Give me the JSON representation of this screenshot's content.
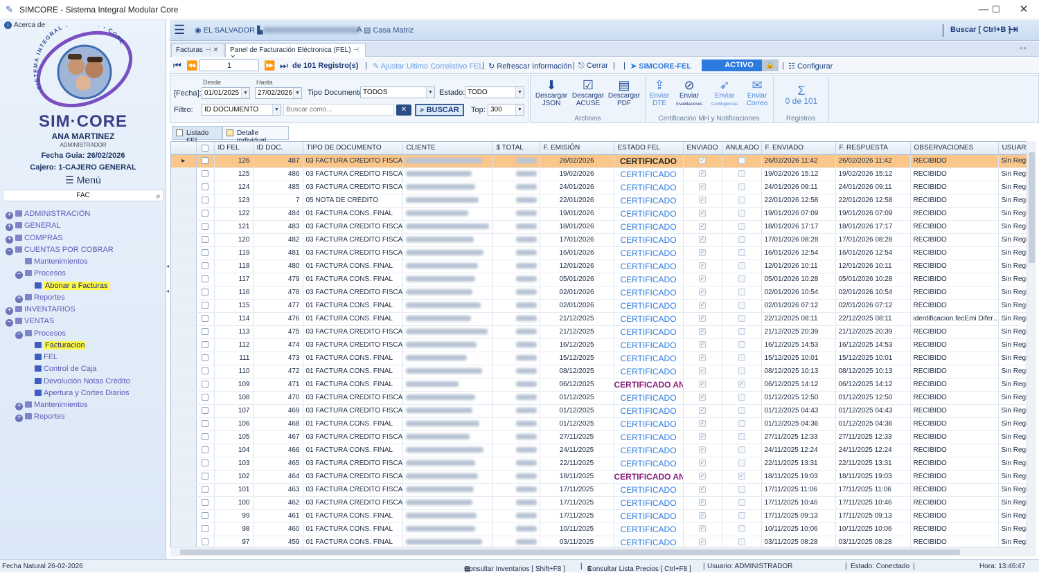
{
  "window": {
    "title": "SIMCORE - Sistema Integral Modular Core"
  },
  "sidebar": {
    "about": "Acerca de",
    "logo_arc": "SISTEMA INTEGRAL MODULAR - CORE",
    "brand": "SIM·CORE",
    "user": "ANA MARTINEZ",
    "role": "ADMINISTRADOR",
    "fecha_guia": "Fecha Guia: 26/02/2026",
    "cajero": "Cajero: 1-CAJERO GENERAL",
    "menu": "Menú",
    "search_value": "FAC",
    "tree": [
      {
        "label": "ADMINISTRACIÓN",
        "level": 0,
        "pm": "+"
      },
      {
        "label": "GENERAL",
        "level": 0,
        "pm": "+"
      },
      {
        "label": "COMPRAS",
        "level": 0,
        "pm": "+"
      },
      {
        "label": "CUENTAS POR COBRAR",
        "level": 0,
        "pm": "−"
      },
      {
        "label": "Mantenimientos",
        "level": 1,
        "pm": ""
      },
      {
        "label": "Procesos",
        "level": 1,
        "pm": "−"
      },
      {
        "label": "Abonar a Facturas",
        "level": 2,
        "pm": "",
        "sel": true
      },
      {
        "label": "Reportes",
        "level": 1,
        "pm": "+"
      },
      {
        "label": "INVENTARIOS",
        "level": 0,
        "pm": "+"
      },
      {
        "label": "VENTAS",
        "level": 0,
        "pm": "−"
      },
      {
        "label": "Procesos",
        "level": 1,
        "pm": "−"
      },
      {
        "label": "Facturacion",
        "level": 2,
        "pm": "",
        "sel": true
      },
      {
        "label": "FEL",
        "level": 2,
        "pm": ""
      },
      {
        "label": "Control de Caja",
        "level": 2,
        "pm": ""
      },
      {
        "label": "Devolución Notas Crédito",
        "level": 2,
        "pm": ""
      },
      {
        "label": "Apertura y Cortes Diarios",
        "level": 2,
        "pm": ""
      },
      {
        "label": "Mantenimientos",
        "level": 1,
        "pm": "+"
      },
      {
        "label": "Reportes",
        "level": 1,
        "pm": "+"
      }
    ]
  },
  "topbar": {
    "country": "EL SALVADOR",
    "suffix": "A",
    "branch": "Casa Matriz",
    "search": "Buscar [ Ctrl+B ]"
  },
  "doc_tabs": [
    {
      "label": "Facturas"
    },
    {
      "label": "Panel de Facturación Eléctronica (FEL)"
    }
  ],
  "nav": {
    "record": "1",
    "of_records": "de 101 Registro(s)",
    "ajustar": "Ajustar Ultimo Correlativo FEL",
    "refrescar": "Refrescar Información",
    "cerrar": "Cerrar",
    "simcore_fel": "SIMCORE-FEL",
    "activo": "ACTIVO",
    "configurar": "Configurar"
  },
  "filters": {
    "fecha_label": "[Fecha]:",
    "desde_label": "Desde",
    "desde": "01/01/2025",
    "hasta_label": "Hasta",
    "hasta": "27/02/2026",
    "tipo_label": "Tipo Documento:",
    "tipo": "TODOS",
    "estado_label": "Estado:",
    "estado": "TODO",
    "filtro_label": "Filtro:",
    "filtro": "ID DOCUMENTO",
    "buscar_placeholder": "Buscar como...",
    "buscar": "BUSCAR",
    "top_label": "Top:",
    "top": "300"
  },
  "ribbon": {
    "buttons": [
      {
        "label1": "Descargar",
        "label2": "JSON",
        "icon": "download-icon"
      },
      {
        "label1": "Descargar",
        "label2": "ACUSE",
        "icon": "check-icon"
      },
      {
        "label1": "Descargar",
        "label2": "PDF",
        "icon": "pdf-icon"
      },
      {
        "label1": "Enviar",
        "label2": "DTE",
        "icon": "upload-icon"
      },
      {
        "label1": "Enviar",
        "label2": "Invalidaciones",
        "icon": "cancel-icon"
      },
      {
        "label1": "Enviar",
        "label2": "Contingencias",
        "icon": "send-icon"
      },
      {
        "label1": "Enviar",
        "label2": "Correo",
        "icon": "mail-icon"
      }
    ],
    "count": "0 de 101",
    "groups": {
      "archivos": "Archivos",
      "cert": "Certificación MH y Notificaciones",
      "registros": "Registros"
    }
  },
  "sub_tabs": [
    {
      "label": "Listado FEL"
    },
    {
      "label": "Detalle Individual"
    }
  ],
  "table": {
    "headers": [
      "ID FEL",
      "ID DOC.",
      "TIPO DE DOCUMENTO",
      "CLIENTE",
      "$ TOTAL",
      "F. EMISIÓN",
      "ESTADO FEL",
      "ENVIADO",
      "ANULADO",
      "F. ENVIADO",
      "F. RESPUESTA",
      "OBSERVACIONES",
      "USUAR"
    ],
    "rows": [
      {
        "id": "126",
        "doc": "487",
        "tipo": "03 FACTURA CREDITO FISCAL",
        "emision": "26/02/2026",
        "estado": "CERTIFICADO",
        "anulado": false,
        "enviado_f": "26/02/2026 11:42",
        "respuesta": "26/02/2026 11:42",
        "obs": "RECIBIDO",
        "usuario": "Sin Regi"
      },
      {
        "id": "125",
        "doc": "486",
        "tipo": "03 FACTURA CREDITO FISCAL",
        "emision": "19/02/2026",
        "estado": "CERTIFICADO",
        "anulado": false,
        "enviado_f": "19/02/2026 15:12",
        "respuesta": "19/02/2026 15:12",
        "obs": "RECIBIDO",
        "usuario": "Sin Regi"
      },
      {
        "id": "124",
        "doc": "485",
        "tipo": "03 FACTURA CREDITO FISCAL",
        "emision": "24/01/2026",
        "estado": "CERTIFICADO",
        "anulado": false,
        "enviado_f": "24/01/2026 09:11",
        "respuesta": "24/01/2026 09:11",
        "obs": "RECIBIDO",
        "usuario": "Sin Regi"
      },
      {
        "id": "123",
        "doc": "7",
        "tipo": "05 NOTA DE CRÉDITO",
        "emision": "22/01/2026",
        "estado": "CERTIFICADO",
        "anulado": false,
        "enviado_f": "22/01/2026 12:58",
        "respuesta": "22/01/2026 12:58",
        "obs": "RECIBIDO",
        "usuario": "Sin Regi"
      },
      {
        "id": "122",
        "doc": "484",
        "tipo": "01 FACTURA CONS. FINAL",
        "emision": "19/01/2026",
        "estado": "CERTIFICADO",
        "anulado": false,
        "enviado_f": "19/01/2026 07:09",
        "respuesta": "19/01/2026 07:09",
        "obs": "RECIBIDO",
        "usuario": "Sin Regi"
      },
      {
        "id": "121",
        "doc": "483",
        "tipo": "03 FACTURA CREDITO FISCAL",
        "emision": "18/01/2026",
        "estado": "CERTIFICADO",
        "anulado": false,
        "enviado_f": "18/01/2026 17:17",
        "respuesta": "18/01/2026 17:17",
        "obs": "RECIBIDO",
        "usuario": "Sin Regi"
      },
      {
        "id": "120",
        "doc": "482",
        "tipo": "03 FACTURA CREDITO FISCAL",
        "emision": "17/01/2026",
        "estado": "CERTIFICADO",
        "anulado": false,
        "enviado_f": "17/01/2026 08:28",
        "respuesta": "17/01/2026 08:28",
        "obs": "RECIBIDO",
        "usuario": "Sin Regi"
      },
      {
        "id": "119",
        "doc": "481",
        "tipo": "03 FACTURA CREDITO FISCAL",
        "emision": "16/01/2026",
        "estado": "CERTIFICADO",
        "anulado": false,
        "enviado_f": "16/01/2026 12:54",
        "respuesta": "16/01/2026 12:54",
        "obs": "RECIBIDO",
        "usuario": "Sin Regi"
      },
      {
        "id": "118",
        "doc": "480",
        "tipo": "01 FACTURA CONS. FINAL",
        "emision": "12/01/2026",
        "estado": "CERTIFICADO",
        "anulado": false,
        "enviado_f": "12/01/2026 10:11",
        "respuesta": "12/01/2026 10:11",
        "obs": "RECIBIDO",
        "usuario": "Sin Regi"
      },
      {
        "id": "117",
        "doc": "479",
        "tipo": "01 FACTURA CONS. FINAL",
        "emision": "05/01/2026",
        "estado": "CERTIFICADO",
        "anulado": false,
        "enviado_f": "05/01/2026 10:28",
        "respuesta": "05/01/2026 10:28",
        "obs": "RECIBIDO",
        "usuario": "Sin Regi"
      },
      {
        "id": "116",
        "doc": "478",
        "tipo": "03 FACTURA CREDITO FISCAL",
        "emision": "02/01/2026",
        "estado": "CERTIFICADO",
        "anulado": false,
        "enviado_f": "02/01/2026 10:54",
        "respuesta": "02/01/2026 10:54",
        "obs": "RECIBIDO",
        "usuario": "Sin Regi"
      },
      {
        "id": "115",
        "doc": "477",
        "tipo": "01 FACTURA CONS. FINAL",
        "emision": "02/01/2026",
        "estado": "CERTIFICADO",
        "anulado": false,
        "enviado_f": "02/01/2026 07:12",
        "respuesta": "02/01/2026 07:12",
        "obs": "RECIBIDO",
        "usuario": "Sin Regi"
      },
      {
        "id": "114",
        "doc": "476",
        "tipo": "01 FACTURA CONS. FINAL",
        "emision": "21/12/2025",
        "estado": "CERTIFICADO",
        "anulado": false,
        "enviado_f": "22/12/2025 08:11",
        "respuesta": "22/12/2025 08:11",
        "obs": "identificacion.fecEmi Difer…",
        "usuario": "Sin Regi"
      },
      {
        "id": "113",
        "doc": "475",
        "tipo": "03 FACTURA CREDITO FISCAL",
        "emision": "21/12/2025",
        "estado": "CERTIFICADO",
        "anulado": false,
        "enviado_f": "21/12/2025 20:39",
        "respuesta": "21/12/2025 20:39",
        "obs": "RECIBIDO",
        "usuario": "Sin Regi"
      },
      {
        "id": "112",
        "doc": "474",
        "tipo": "03 FACTURA CREDITO FISCAL",
        "emision": "16/12/2025",
        "estado": "CERTIFICADO",
        "anulado": false,
        "enviado_f": "16/12/2025 14:53",
        "respuesta": "16/12/2025 14:53",
        "obs": "RECIBIDO",
        "usuario": "Sin Regi"
      },
      {
        "id": "111",
        "doc": "473",
        "tipo": "01 FACTURA CONS. FINAL",
        "emision": "15/12/2025",
        "estado": "CERTIFICADO",
        "anulado": false,
        "enviado_f": "15/12/2025 10:01",
        "respuesta": "15/12/2025 10:01",
        "obs": "RECIBIDO",
        "usuario": "Sin Regi"
      },
      {
        "id": "110",
        "doc": "472",
        "tipo": "01 FACTURA CONS. FINAL",
        "emision": "08/12/2025",
        "estado": "CERTIFICADO",
        "anulado": false,
        "enviado_f": "08/12/2025 10:13",
        "respuesta": "08/12/2025 10:13",
        "obs": "RECIBIDO",
        "usuario": "Sin Regi"
      },
      {
        "id": "109",
        "doc": "471",
        "tipo": "01 FACTURA CONS. FINAL",
        "emision": "06/12/2025",
        "estado": "CERTIFICADO AN",
        "anulado": true,
        "enviado_f": "06/12/2025 14:12",
        "respuesta": "06/12/2025 14:12",
        "obs": "RECIBIDO",
        "usuario": "Sin Regi"
      },
      {
        "id": "108",
        "doc": "470",
        "tipo": "03 FACTURA CREDITO FISCAL",
        "emision": "01/12/2025",
        "estado": "CERTIFICADO",
        "anulado": false,
        "enviado_f": "01/12/2025 12:50",
        "respuesta": "01/12/2025 12:50",
        "obs": "RECIBIDO",
        "usuario": "Sin Regi"
      },
      {
        "id": "107",
        "doc": "469",
        "tipo": "03 FACTURA CREDITO FISCAL",
        "emision": "01/12/2025",
        "estado": "CERTIFICADO",
        "anulado": false,
        "enviado_f": "01/12/2025 04:43",
        "respuesta": "01/12/2025 04:43",
        "obs": "RECIBIDO",
        "usuario": "Sin Regi"
      },
      {
        "id": "106",
        "doc": "468",
        "tipo": "01 FACTURA CONS. FINAL",
        "emision": "01/12/2025",
        "estado": "CERTIFICADO",
        "anulado": false,
        "enviado_f": "01/12/2025 04:36",
        "respuesta": "01/12/2025 04:36",
        "obs": "RECIBIDO",
        "usuario": "Sin Regi"
      },
      {
        "id": "105",
        "doc": "467",
        "tipo": "03 FACTURA CREDITO FISCAL",
        "emision": "27/11/2025",
        "estado": "CERTIFICADO",
        "anulado": false,
        "enviado_f": "27/11/2025 12:33",
        "respuesta": "27/11/2025 12:33",
        "obs": "RECIBIDO",
        "usuario": "Sin Regi"
      },
      {
        "id": "104",
        "doc": "466",
        "tipo": "01 FACTURA CONS. FINAL",
        "emision": "24/11/2025",
        "estado": "CERTIFICADO",
        "anulado": false,
        "enviado_f": "24/11/2025 12:24",
        "respuesta": "24/11/2025 12:24",
        "obs": "RECIBIDO",
        "usuario": "Sin Regi"
      },
      {
        "id": "103",
        "doc": "465",
        "tipo": "03 FACTURA CREDITO FISCAL",
        "emision": "22/11/2025",
        "estado": "CERTIFICADO",
        "anulado": false,
        "enviado_f": "22/11/2025 13:31",
        "respuesta": "22/11/2025 13:31",
        "obs": "RECIBIDO",
        "usuario": "Sin Regi"
      },
      {
        "id": "102",
        "doc": "464",
        "tipo": "03 FACTURA CREDITO FISCAL",
        "emision": "18/11/2025",
        "estado": "CERTIFICADO AN",
        "anulado": true,
        "enviado_f": "18/11/2025 19:03",
        "respuesta": "18/11/2025 19:03",
        "obs": "RECIBIDO",
        "usuario": "Sin Regi"
      },
      {
        "id": "101",
        "doc": "463",
        "tipo": "03 FACTURA CREDITO FISCAL",
        "emision": "17/11/2025",
        "estado": "CERTIFICADO",
        "anulado": false,
        "enviado_f": "17/11/2025 11:06",
        "respuesta": "17/11/2025 11:06",
        "obs": "RECIBIDO",
        "usuario": "Sin Regi"
      },
      {
        "id": "100",
        "doc": "462",
        "tipo": "03 FACTURA CREDITO FISCAL",
        "emision": "17/11/2025",
        "estado": "CERTIFICADO",
        "anulado": false,
        "enviado_f": "17/11/2025 10:46",
        "respuesta": "17/11/2025 10:46",
        "obs": "RECIBIDO",
        "usuario": "Sin Regi"
      },
      {
        "id": "99",
        "doc": "461",
        "tipo": "01 FACTURA CONS. FINAL",
        "emision": "17/11/2025",
        "estado": "CERTIFICADO",
        "anulado": false,
        "enviado_f": "17/11/2025 09:13",
        "respuesta": "17/11/2025 09:13",
        "obs": "RECIBIDO",
        "usuario": "Sin Regi"
      },
      {
        "id": "98",
        "doc": "460",
        "tipo": "01 FACTURA CONS. FINAL",
        "emision": "10/11/2025",
        "estado": "CERTIFICADO",
        "anulado": false,
        "enviado_f": "10/11/2025 10:06",
        "respuesta": "10/11/2025 10:06",
        "obs": "RECIBIDO",
        "usuario": "Sin Regi"
      },
      {
        "id": "97",
        "doc": "459",
        "tipo": "01 FACTURA CONS. FINAL",
        "emision": "03/11/2025",
        "estado": "CERTIFICADO",
        "anulado": false,
        "enviado_f": "03/11/2025 08:28",
        "respuesta": "03/11/2025 08:28",
        "obs": "RECIBIDO",
        "usuario": "Sin Regi"
      }
    ]
  },
  "statusbar": {
    "fecha": "Fecha Natural 26-02-2026",
    "inventarios": "Consultar Inventarios [ Shift+F8 ]",
    "precios": "Consultar Lista Precios [ Ctrl+F8 ]",
    "usuario": "Usuario: ADMINISTRADOR",
    "estado": "Estado: Conectado",
    "hora": "Hora: 13:46:47"
  },
  "colors": {
    "accent": "#2e7be0",
    "selected_row": "#fbc68a",
    "anulado": "#8b1e7c",
    "highlight": "#fff94a"
  }
}
